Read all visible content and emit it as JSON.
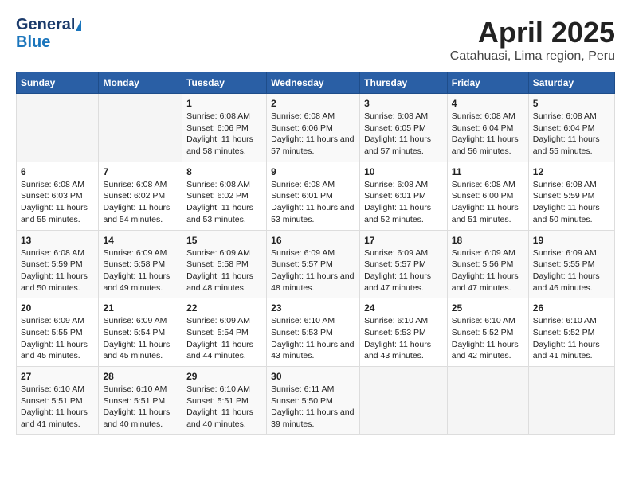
{
  "header": {
    "logo_general": "General",
    "logo_blue": "Blue",
    "title": "April 2025",
    "subtitle": "Catahuasi, Lima region, Peru"
  },
  "weekdays": [
    "Sunday",
    "Monday",
    "Tuesday",
    "Wednesday",
    "Thursday",
    "Friday",
    "Saturday"
  ],
  "weeks": [
    [
      {
        "day": "",
        "empty": true
      },
      {
        "day": "",
        "empty": true
      },
      {
        "day": "1",
        "sunrise": "Sunrise: 6:08 AM",
        "sunset": "Sunset: 6:06 PM",
        "daylight": "Daylight: 11 hours and 58 minutes."
      },
      {
        "day": "2",
        "sunrise": "Sunrise: 6:08 AM",
        "sunset": "Sunset: 6:06 PM",
        "daylight": "Daylight: 11 hours and 57 minutes."
      },
      {
        "day": "3",
        "sunrise": "Sunrise: 6:08 AM",
        "sunset": "Sunset: 6:05 PM",
        "daylight": "Daylight: 11 hours and 57 minutes."
      },
      {
        "day": "4",
        "sunrise": "Sunrise: 6:08 AM",
        "sunset": "Sunset: 6:04 PM",
        "daylight": "Daylight: 11 hours and 56 minutes."
      },
      {
        "day": "5",
        "sunrise": "Sunrise: 6:08 AM",
        "sunset": "Sunset: 6:04 PM",
        "daylight": "Daylight: 11 hours and 55 minutes."
      }
    ],
    [
      {
        "day": "6",
        "sunrise": "Sunrise: 6:08 AM",
        "sunset": "Sunset: 6:03 PM",
        "daylight": "Daylight: 11 hours and 55 minutes."
      },
      {
        "day": "7",
        "sunrise": "Sunrise: 6:08 AM",
        "sunset": "Sunset: 6:02 PM",
        "daylight": "Daylight: 11 hours and 54 minutes."
      },
      {
        "day": "8",
        "sunrise": "Sunrise: 6:08 AM",
        "sunset": "Sunset: 6:02 PM",
        "daylight": "Daylight: 11 hours and 53 minutes."
      },
      {
        "day": "9",
        "sunrise": "Sunrise: 6:08 AM",
        "sunset": "Sunset: 6:01 PM",
        "daylight": "Daylight: 11 hours and 53 minutes."
      },
      {
        "day": "10",
        "sunrise": "Sunrise: 6:08 AM",
        "sunset": "Sunset: 6:01 PM",
        "daylight": "Daylight: 11 hours and 52 minutes."
      },
      {
        "day": "11",
        "sunrise": "Sunrise: 6:08 AM",
        "sunset": "Sunset: 6:00 PM",
        "daylight": "Daylight: 11 hours and 51 minutes."
      },
      {
        "day": "12",
        "sunrise": "Sunrise: 6:08 AM",
        "sunset": "Sunset: 5:59 PM",
        "daylight": "Daylight: 11 hours and 50 minutes."
      }
    ],
    [
      {
        "day": "13",
        "sunrise": "Sunrise: 6:08 AM",
        "sunset": "Sunset: 5:59 PM",
        "daylight": "Daylight: 11 hours and 50 minutes."
      },
      {
        "day": "14",
        "sunrise": "Sunrise: 6:09 AM",
        "sunset": "Sunset: 5:58 PM",
        "daylight": "Daylight: 11 hours and 49 minutes."
      },
      {
        "day": "15",
        "sunrise": "Sunrise: 6:09 AM",
        "sunset": "Sunset: 5:58 PM",
        "daylight": "Daylight: 11 hours and 48 minutes."
      },
      {
        "day": "16",
        "sunrise": "Sunrise: 6:09 AM",
        "sunset": "Sunset: 5:57 PM",
        "daylight": "Daylight: 11 hours and 48 minutes."
      },
      {
        "day": "17",
        "sunrise": "Sunrise: 6:09 AM",
        "sunset": "Sunset: 5:57 PM",
        "daylight": "Daylight: 11 hours and 47 minutes."
      },
      {
        "day": "18",
        "sunrise": "Sunrise: 6:09 AM",
        "sunset": "Sunset: 5:56 PM",
        "daylight": "Daylight: 11 hours and 47 minutes."
      },
      {
        "day": "19",
        "sunrise": "Sunrise: 6:09 AM",
        "sunset": "Sunset: 5:55 PM",
        "daylight": "Daylight: 11 hours and 46 minutes."
      }
    ],
    [
      {
        "day": "20",
        "sunrise": "Sunrise: 6:09 AM",
        "sunset": "Sunset: 5:55 PM",
        "daylight": "Daylight: 11 hours and 45 minutes."
      },
      {
        "day": "21",
        "sunrise": "Sunrise: 6:09 AM",
        "sunset": "Sunset: 5:54 PM",
        "daylight": "Daylight: 11 hours and 45 minutes."
      },
      {
        "day": "22",
        "sunrise": "Sunrise: 6:09 AM",
        "sunset": "Sunset: 5:54 PM",
        "daylight": "Daylight: 11 hours and 44 minutes."
      },
      {
        "day": "23",
        "sunrise": "Sunrise: 6:10 AM",
        "sunset": "Sunset: 5:53 PM",
        "daylight": "Daylight: 11 hours and 43 minutes."
      },
      {
        "day": "24",
        "sunrise": "Sunrise: 6:10 AM",
        "sunset": "Sunset: 5:53 PM",
        "daylight": "Daylight: 11 hours and 43 minutes."
      },
      {
        "day": "25",
        "sunrise": "Sunrise: 6:10 AM",
        "sunset": "Sunset: 5:52 PM",
        "daylight": "Daylight: 11 hours and 42 minutes."
      },
      {
        "day": "26",
        "sunrise": "Sunrise: 6:10 AM",
        "sunset": "Sunset: 5:52 PM",
        "daylight": "Daylight: 11 hours and 41 minutes."
      }
    ],
    [
      {
        "day": "27",
        "sunrise": "Sunrise: 6:10 AM",
        "sunset": "Sunset: 5:51 PM",
        "daylight": "Daylight: 11 hours and 41 minutes."
      },
      {
        "day": "28",
        "sunrise": "Sunrise: 6:10 AM",
        "sunset": "Sunset: 5:51 PM",
        "daylight": "Daylight: 11 hours and 40 minutes."
      },
      {
        "day": "29",
        "sunrise": "Sunrise: 6:10 AM",
        "sunset": "Sunset: 5:51 PM",
        "daylight": "Daylight: 11 hours and 40 minutes."
      },
      {
        "day": "30",
        "sunrise": "Sunrise: 6:11 AM",
        "sunset": "Sunset: 5:50 PM",
        "daylight": "Daylight: 11 hours and 39 minutes."
      },
      {
        "day": "",
        "empty": true
      },
      {
        "day": "",
        "empty": true
      },
      {
        "day": "",
        "empty": true
      }
    ]
  ]
}
